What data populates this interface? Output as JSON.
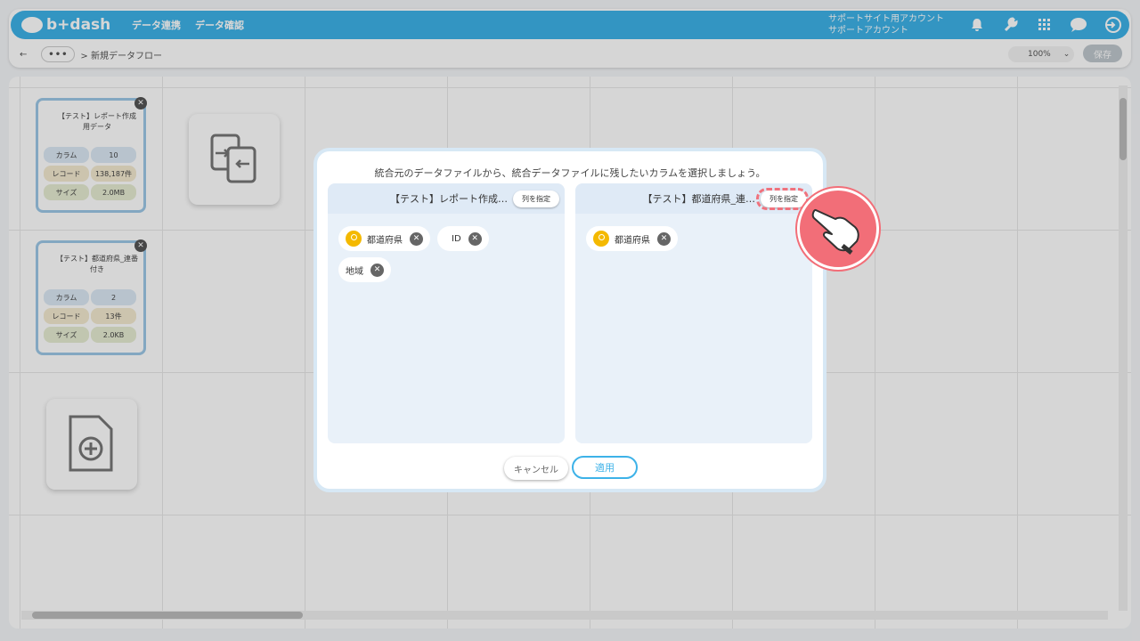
{
  "header": {
    "brand": "b+dash",
    "nav": [
      "データ連携",
      "データ確認"
    ],
    "account_line1": "サポートサイト用アカウント",
    "account_line2": "サポートアカウント",
    "icons": [
      "bell-icon",
      "wrench-icon",
      "grid-icon",
      "chat-icon",
      "logout-icon"
    ]
  },
  "breadcrumb": {
    "back": "←",
    "more": "•••",
    "path": "> 新規データフロー"
  },
  "toolbar": {
    "zoom": "100%",
    "save": "保存"
  },
  "file_cards": [
    {
      "title": "【テスト】レポート作成用データ",
      "columns_label": "カラム",
      "columns": "10",
      "records_label": "レコード",
      "records": "138,187件",
      "size_label": "サイズ",
      "size": "2.0MB"
    },
    {
      "title": "【テスト】都道府県_連番付き",
      "columns_label": "カラム",
      "columns": "2",
      "records_label": "レコード",
      "records": "13件",
      "size_label": "サイズ",
      "size": "2.0KB"
    }
  ],
  "modal": {
    "instruction": "統合元のデータファイルから、統合データファイルに残したいカラムを選択しましょう。",
    "left_panel": {
      "title": "【テスト】レポート作成…",
      "button": "列を指定",
      "chips": [
        {
          "label": "都道府県",
          "key": true
        },
        {
          "label": "ID",
          "key": false
        },
        {
          "label": "地域",
          "key": false
        }
      ]
    },
    "right_panel": {
      "title": "【テスト】都道府県_連…",
      "button": "列を指定",
      "chips": [
        {
          "label": "都道府県",
          "key": true
        }
      ]
    },
    "cancel": "キャンセル",
    "apply": "適用"
  },
  "colors": {
    "brand": "#3db2e8",
    "highlight": "#f26e78",
    "key": "#f4b900"
  }
}
